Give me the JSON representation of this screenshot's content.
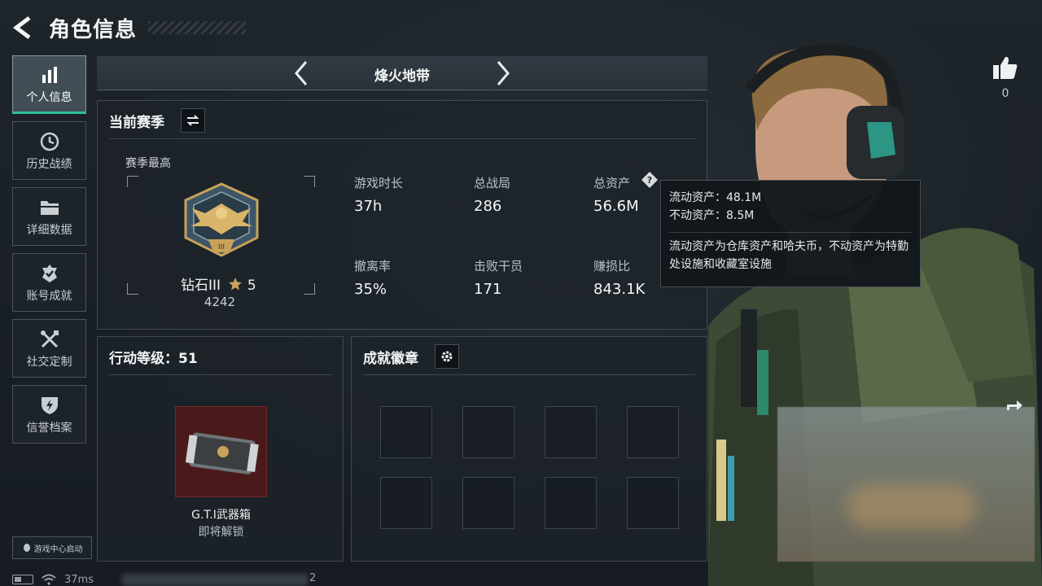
{
  "header": {
    "title": "角色信息"
  },
  "nav": {
    "items": [
      {
        "label": "个人信息",
        "icon": "bar-chart-icon",
        "active": true
      },
      {
        "label": "历史战绩",
        "icon": "clock-icon"
      },
      {
        "label": "详细数据",
        "icon": "folder-icon"
      },
      {
        "label": "账号成就",
        "icon": "achievement-icon"
      },
      {
        "label": "社交定制",
        "icon": "tools-icon"
      },
      {
        "label": "信誉档案",
        "icon": "shield-icon"
      }
    ],
    "launch_label": "游戏中心启动"
  },
  "mode": {
    "label": "烽火地带"
  },
  "season": {
    "title": "当前赛季",
    "best_label": "赛季最高",
    "rank_name": "钻石III",
    "rank_stars": "5",
    "rank_score": "4242",
    "stats": [
      {
        "label": "游戏时长",
        "value": "37h"
      },
      {
        "label": "总战局",
        "value": "286"
      },
      {
        "label": "总资产",
        "value": "56.6M"
      },
      {
        "label": "撤离率",
        "value": "35%"
      },
      {
        "label": "击败干员",
        "value": "171"
      },
      {
        "label": "赚损比",
        "value": "843.1K"
      }
    ]
  },
  "tooltip": {
    "liquid": "流动资产：48.1M",
    "fixed": "不动资产：8.5M",
    "desc": "流动资产为仓库资产和哈夫币，不动资产为特勤处设施和收藏室设施"
  },
  "level": {
    "title": "行动等级：51",
    "reward_name": "G.T.I武器箱",
    "reward_status": "即将解锁"
  },
  "badges": {
    "title": "成就徽章"
  },
  "social": {
    "like_count": "0"
  },
  "status_bar": {
    "ping": "37ms",
    "trail": "2"
  },
  "colors": {
    "accent": "#2fc09a",
    "reward_bg": "#4a1a1a",
    "gold": "#c9a25a"
  }
}
